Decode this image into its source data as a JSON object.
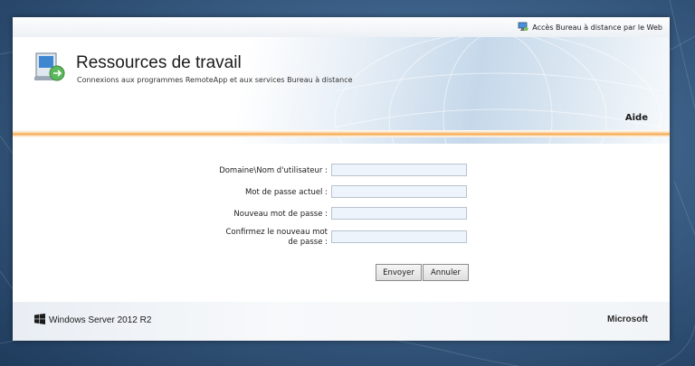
{
  "topbar": {
    "web_access_label": "Accès Bureau à distance par le Web",
    "web_access_icon": "remote-desktop-icon"
  },
  "header": {
    "title": "Ressources de travail",
    "subtitle": "Connexions aux programmes RemoteApp et aux services Bureau à distance",
    "help_label": "Aide",
    "logo_icon": "remoteapp-computer-icon"
  },
  "form": {
    "username_label": "Domaine\\Nom d'utilisateur :",
    "username_value": "",
    "current_password_label": "Mot de passe actuel :",
    "current_password_value": "",
    "new_password_label": "Nouveau mot de passe :",
    "new_password_value": "",
    "confirm_password_label_line1": "Confirmez le nouveau mot",
    "confirm_password_label_line2": "de passe :",
    "confirm_password_value": "",
    "submit_label": "Envoyer",
    "cancel_label": "Annuler"
  },
  "footer": {
    "os_name": "Windows Server 2012 R2",
    "os_icon": "windows-logo-icon",
    "company": "Microsoft"
  },
  "colors": {
    "accent_orange": "#f4a347",
    "input_bg": "#eef4fb",
    "background_blue": "#3b5f86"
  }
}
